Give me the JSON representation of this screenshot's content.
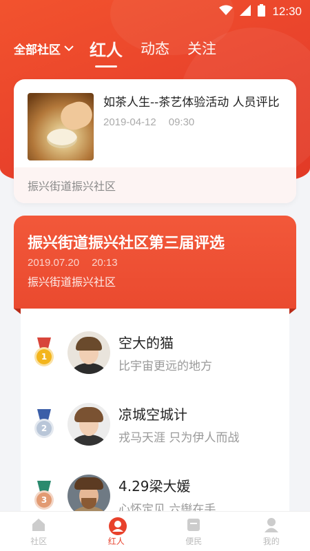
{
  "status": {
    "time": "12:30"
  },
  "header": {
    "community_select": "全部社区",
    "tabs": [
      {
        "label": "红人",
        "active": true
      },
      {
        "label": "动态",
        "active": false
      },
      {
        "label": "关注",
        "active": false
      }
    ]
  },
  "event_card": {
    "title": "如茶人生--茶艺体验活动 人员评比",
    "date": "2019-04-12",
    "time": "09:30",
    "community": "振兴街道振兴社区"
  },
  "selection_card": {
    "title": "振兴街道振兴社区第三届评选",
    "date": "2019.07.20",
    "time": "20:13",
    "community": "振兴街道振兴社区",
    "rankings": [
      {
        "rank": "1",
        "name": "空大的猫",
        "motto": "比宇宙更远的地方"
      },
      {
        "rank": "2",
        "name": "凉城空城计",
        "motto": "戎马天涯 只为伊人而战"
      },
      {
        "rank": "3",
        "name": "4.29梁大媛",
        "motto": "心怀定见 六辔在手"
      }
    ]
  },
  "tabbar": {
    "items": [
      {
        "label": "社区",
        "icon": "community-icon"
      },
      {
        "label": "红人",
        "icon": "star-people-icon"
      },
      {
        "label": "便民",
        "icon": "service-icon"
      },
      {
        "label": "我的",
        "icon": "profile-icon"
      }
    ]
  },
  "colors": {
    "brand": "#e8412b",
    "gold": "#f3b51c",
    "silver": "#b9c6d8",
    "bronze": "#e29a72"
  }
}
